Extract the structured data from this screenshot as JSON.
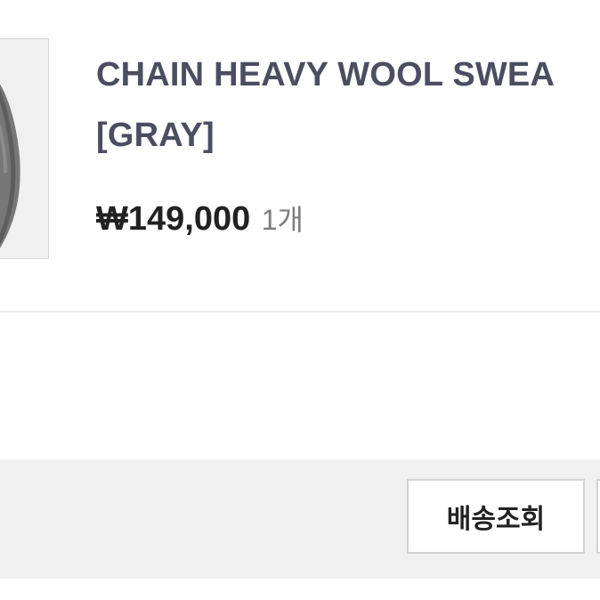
{
  "product": {
    "name_line1": "CHAIN HEAVY WOOL SWEA",
    "name_line2": "[GRAY]",
    "price": "₩149,000",
    "quantity": "1개",
    "thumbnail_alt": "gray sweater thumbnail"
  },
  "actions": {
    "track_delivery_label": "배송조회"
  }
}
